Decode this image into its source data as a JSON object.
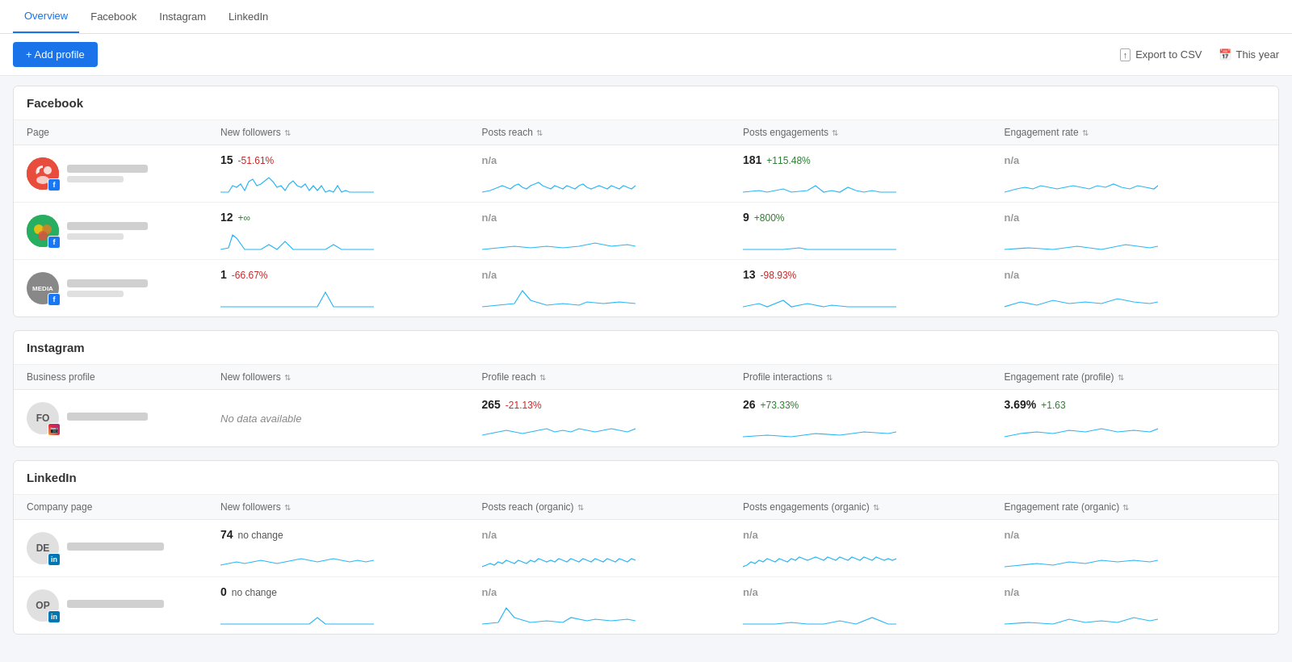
{
  "nav": {
    "items": [
      "Overview",
      "Facebook",
      "Instagram",
      "LinkedIn"
    ],
    "active": "Overview"
  },
  "toolbar": {
    "add_label": "+ Add profile",
    "export_label": "Export to CSV",
    "date_label": "This year"
  },
  "facebook": {
    "section_title": "Facebook",
    "columns": [
      "Page",
      "New followers",
      "Posts reach",
      "Posts engagements",
      "Engagement rate"
    ],
    "rows": [
      {
        "avatar_bg": "#e84c3d",
        "avatar_initials": "",
        "avatar_type": "img1",
        "badge": "fb",
        "new_followers": "15",
        "new_followers_change": "-51.61%",
        "new_followers_change_type": "neg",
        "posts_reach": "n/a",
        "posts_reach_change": "",
        "posts_reach_change_type": "na",
        "posts_engagements": "181",
        "posts_engagements_change": "+115.48%",
        "posts_engagements_change_type": "pos",
        "engagement_rate": "n/a",
        "engagement_rate_change": "",
        "engagement_rate_change_type": "na"
      },
      {
        "avatar_bg": "#2ecc71",
        "avatar_initials": "",
        "avatar_type": "img2",
        "badge": "fb",
        "new_followers": "12",
        "new_followers_change": "+∞",
        "new_followers_change_type": "pos",
        "posts_reach": "n/a",
        "posts_reach_change": "",
        "posts_reach_change_type": "na",
        "posts_engagements": "9",
        "posts_engagements_change": "+800%",
        "posts_engagements_change_type": "pos",
        "engagement_rate": "n/a",
        "engagement_rate_change": "",
        "engagement_rate_change_type": "na"
      },
      {
        "avatar_bg": "#888",
        "avatar_initials": "MEDIA",
        "avatar_type": "text",
        "badge": "fb",
        "new_followers": "1",
        "new_followers_change": "-66.67%",
        "new_followers_change_type": "neg",
        "posts_reach": "n/a",
        "posts_reach_change": "",
        "posts_reach_change_type": "na",
        "posts_engagements": "13",
        "posts_engagements_change": "-98.93%",
        "posts_engagements_change_type": "neg",
        "engagement_rate": "n/a",
        "engagement_rate_change": "",
        "engagement_rate_change_type": "na"
      }
    ]
  },
  "instagram": {
    "section_title": "Instagram",
    "columns": [
      "Business profile",
      "New followers",
      "Profile reach",
      "Profile interactions",
      "Engagement rate (profile)"
    ],
    "rows": [
      {
        "avatar_bg": "#e0e0e0",
        "avatar_initials": "FO",
        "avatar_type": "text_dark",
        "badge": "ig",
        "new_followers": "No data available",
        "new_followers_type": "nodata",
        "profile_reach": "265",
        "profile_reach_change": "-21.13%",
        "profile_reach_change_type": "neg",
        "profile_interactions": "26",
        "profile_interactions_change": "+73.33%",
        "profile_interactions_change_type": "pos",
        "engagement_rate": "3.69%",
        "engagement_rate_change": "+1.63",
        "engagement_rate_change_type": "pos"
      }
    ]
  },
  "linkedin": {
    "section_title": "LinkedIn",
    "columns": [
      "Company page",
      "New followers",
      "Posts reach (organic)",
      "Posts engagements (organic)",
      "Engagement rate (organic)"
    ],
    "rows": [
      {
        "avatar_bg": "#e0e0e0",
        "avatar_initials": "DE",
        "avatar_type": "text_dark",
        "badge": "li",
        "new_followers": "74",
        "new_followers_change": "no change",
        "new_followers_change_type": "neu",
        "posts_reach": "n/a",
        "posts_engagements": "n/a",
        "engagement_rate": "n/a"
      },
      {
        "avatar_bg": "#e0e0e0",
        "avatar_initials": "OP",
        "avatar_type": "text_dark",
        "badge": "li",
        "new_followers": "0",
        "new_followers_change": "no change",
        "new_followers_change_type": "neu",
        "posts_reach": "n/a",
        "posts_engagements": "n/a",
        "engagement_rate": "n/a"
      }
    ]
  }
}
